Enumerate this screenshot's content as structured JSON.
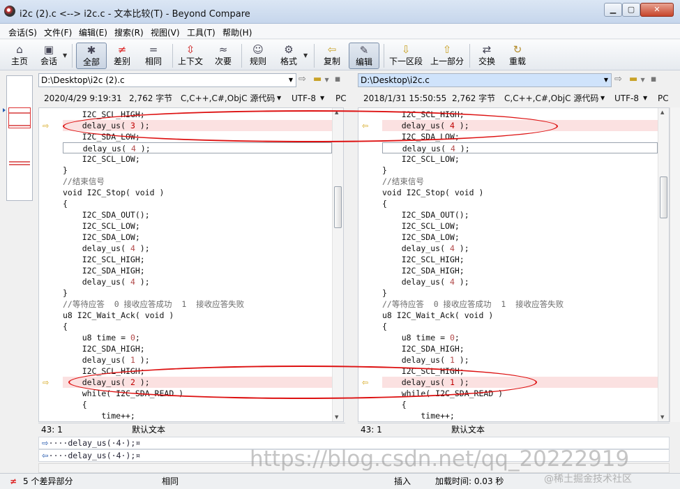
{
  "window": {
    "title": "i2c (2).c <--> i2c.c - 文本比较(T) - Beyond Compare",
    "min": "▁",
    "max": "▢",
    "close": "✕"
  },
  "menu": [
    "会话(S)",
    "文件(F)",
    "编辑(E)",
    "搜索(R)",
    "视图(V)",
    "工具(T)",
    "帮助(H)"
  ],
  "toolbar": [
    {
      "label": "主页",
      "icon": "⌂"
    },
    {
      "label": "会话",
      "icon": "▣"
    },
    {
      "label": "全部",
      "icon": "✱"
    },
    {
      "label": "差别",
      "icon": "≠"
    },
    {
      "label": "相同",
      "icon": "="
    },
    {
      "label": "上下文",
      "icon": "⇳"
    },
    {
      "label": "次要",
      "icon": "≈"
    },
    {
      "label": "规则",
      "icon": "☺"
    },
    {
      "label": "格式",
      "icon": "⚙"
    },
    {
      "label": "复制",
      "icon": "⇦"
    },
    {
      "label": "编辑",
      "icon": "✎"
    },
    {
      "label": "下一区段",
      "icon": "⇩"
    },
    {
      "label": "上一部分",
      "icon": "⇧"
    },
    {
      "label": "交换",
      "icon": "⇄"
    },
    {
      "label": "重载",
      "icon": "↻"
    }
  ],
  "left": {
    "path": "D:\\Desktop\\i2c (2).c",
    "date": "2020/4/29 9:19:31",
    "size": "2,762 字节",
    "format": "C,C++,C#,ObjC 源代码",
    "encoding": "UTF-8",
    "eol": "PC",
    "status_pos": "43: 1",
    "status_text": "默认文本"
  },
  "right": {
    "path": "D:\\Desktop\\i2c.c",
    "date": "2018/1/31 15:50:55",
    "size": "2,762 字节",
    "format": "C,C++,C#,ObjC 源代码",
    "encoding": "UTF-8",
    "eol": "PC",
    "status_pos": "43: 1",
    "status_text": "默认文本"
  },
  "left_lines": [
    "    I2C_SCL_HIGH;",
    "    delay_us( 3 );",
    "    I2C_SDA_LOW;",
    "    delay_us( 4 );",
    "    I2C_SCL_LOW;",
    "}",
    "//结束信号",
    "void I2C_Stop( void )",
    "{",
    "    I2C_SDA_OUT();",
    "    I2C_SCL_LOW;",
    "    I2C_SDA_LOW;",
    "    delay_us( 4 );",
    "    I2C_SCL_HIGH;",
    "    I2C_SDA_HIGH;",
    "    delay_us( 4 );",
    "}",
    "//等待应答  0 接收应答成功  1  接收应答失败",
    "u8 I2C_Wait_Ack( void )",
    "{",
    "    u8 time = 0;",
    "    I2C_SDA_HIGH;",
    "    delay_us( 1 );",
    "    I2C_SCL_HIGH;",
    "    delay_us( 2 );",
    "    while( I2C_SDA_READ )",
    "    {",
    "        time++;"
  ],
  "right_lines": [
    "    I2C_SCL_HIGH;",
    "    delay_us( 4 );",
    "    I2C_SDA_LOW;",
    "    delay_us( 4 );",
    "    I2C_SCL_LOW;",
    "}",
    "//结束信号",
    "void I2C_Stop( void )",
    "{",
    "    I2C_SDA_OUT();",
    "    I2C_SCL_LOW;",
    "    I2C_SDA_LOW;",
    "    delay_us( 4 );",
    "    I2C_SCL_HIGH;",
    "    I2C_SDA_HIGH;",
    "    delay_us( 4 );",
    "}",
    "//等待应答  0 接收应答成功  1  接收应答失败",
    "u8 I2C_Wait_Ack( void )",
    "{",
    "    u8 time = 0;",
    "    I2C_SDA_HIGH;",
    "    delay_us( 1 );",
    "    I2C_SCL_HIGH;",
    "    delay_us( 1 );",
    "    while( I2C_SDA_READ )",
    "    {",
    "        time++;"
  ],
  "diff_lines": [
    1,
    24
  ],
  "line_detail": {
    "left": "····delay_us(·4·);¤",
    "right": "····delay_us(·4·);¤"
  },
  "statusbar": {
    "diff_count": "5 个差异部分",
    "same": "相同",
    "insert": "插入",
    "load_time": "加载时间: 0.03 秒"
  },
  "watermark": "https://blog.csdn.net/qq_20222919",
  "watermark2": "@稀土掘金技术社区"
}
